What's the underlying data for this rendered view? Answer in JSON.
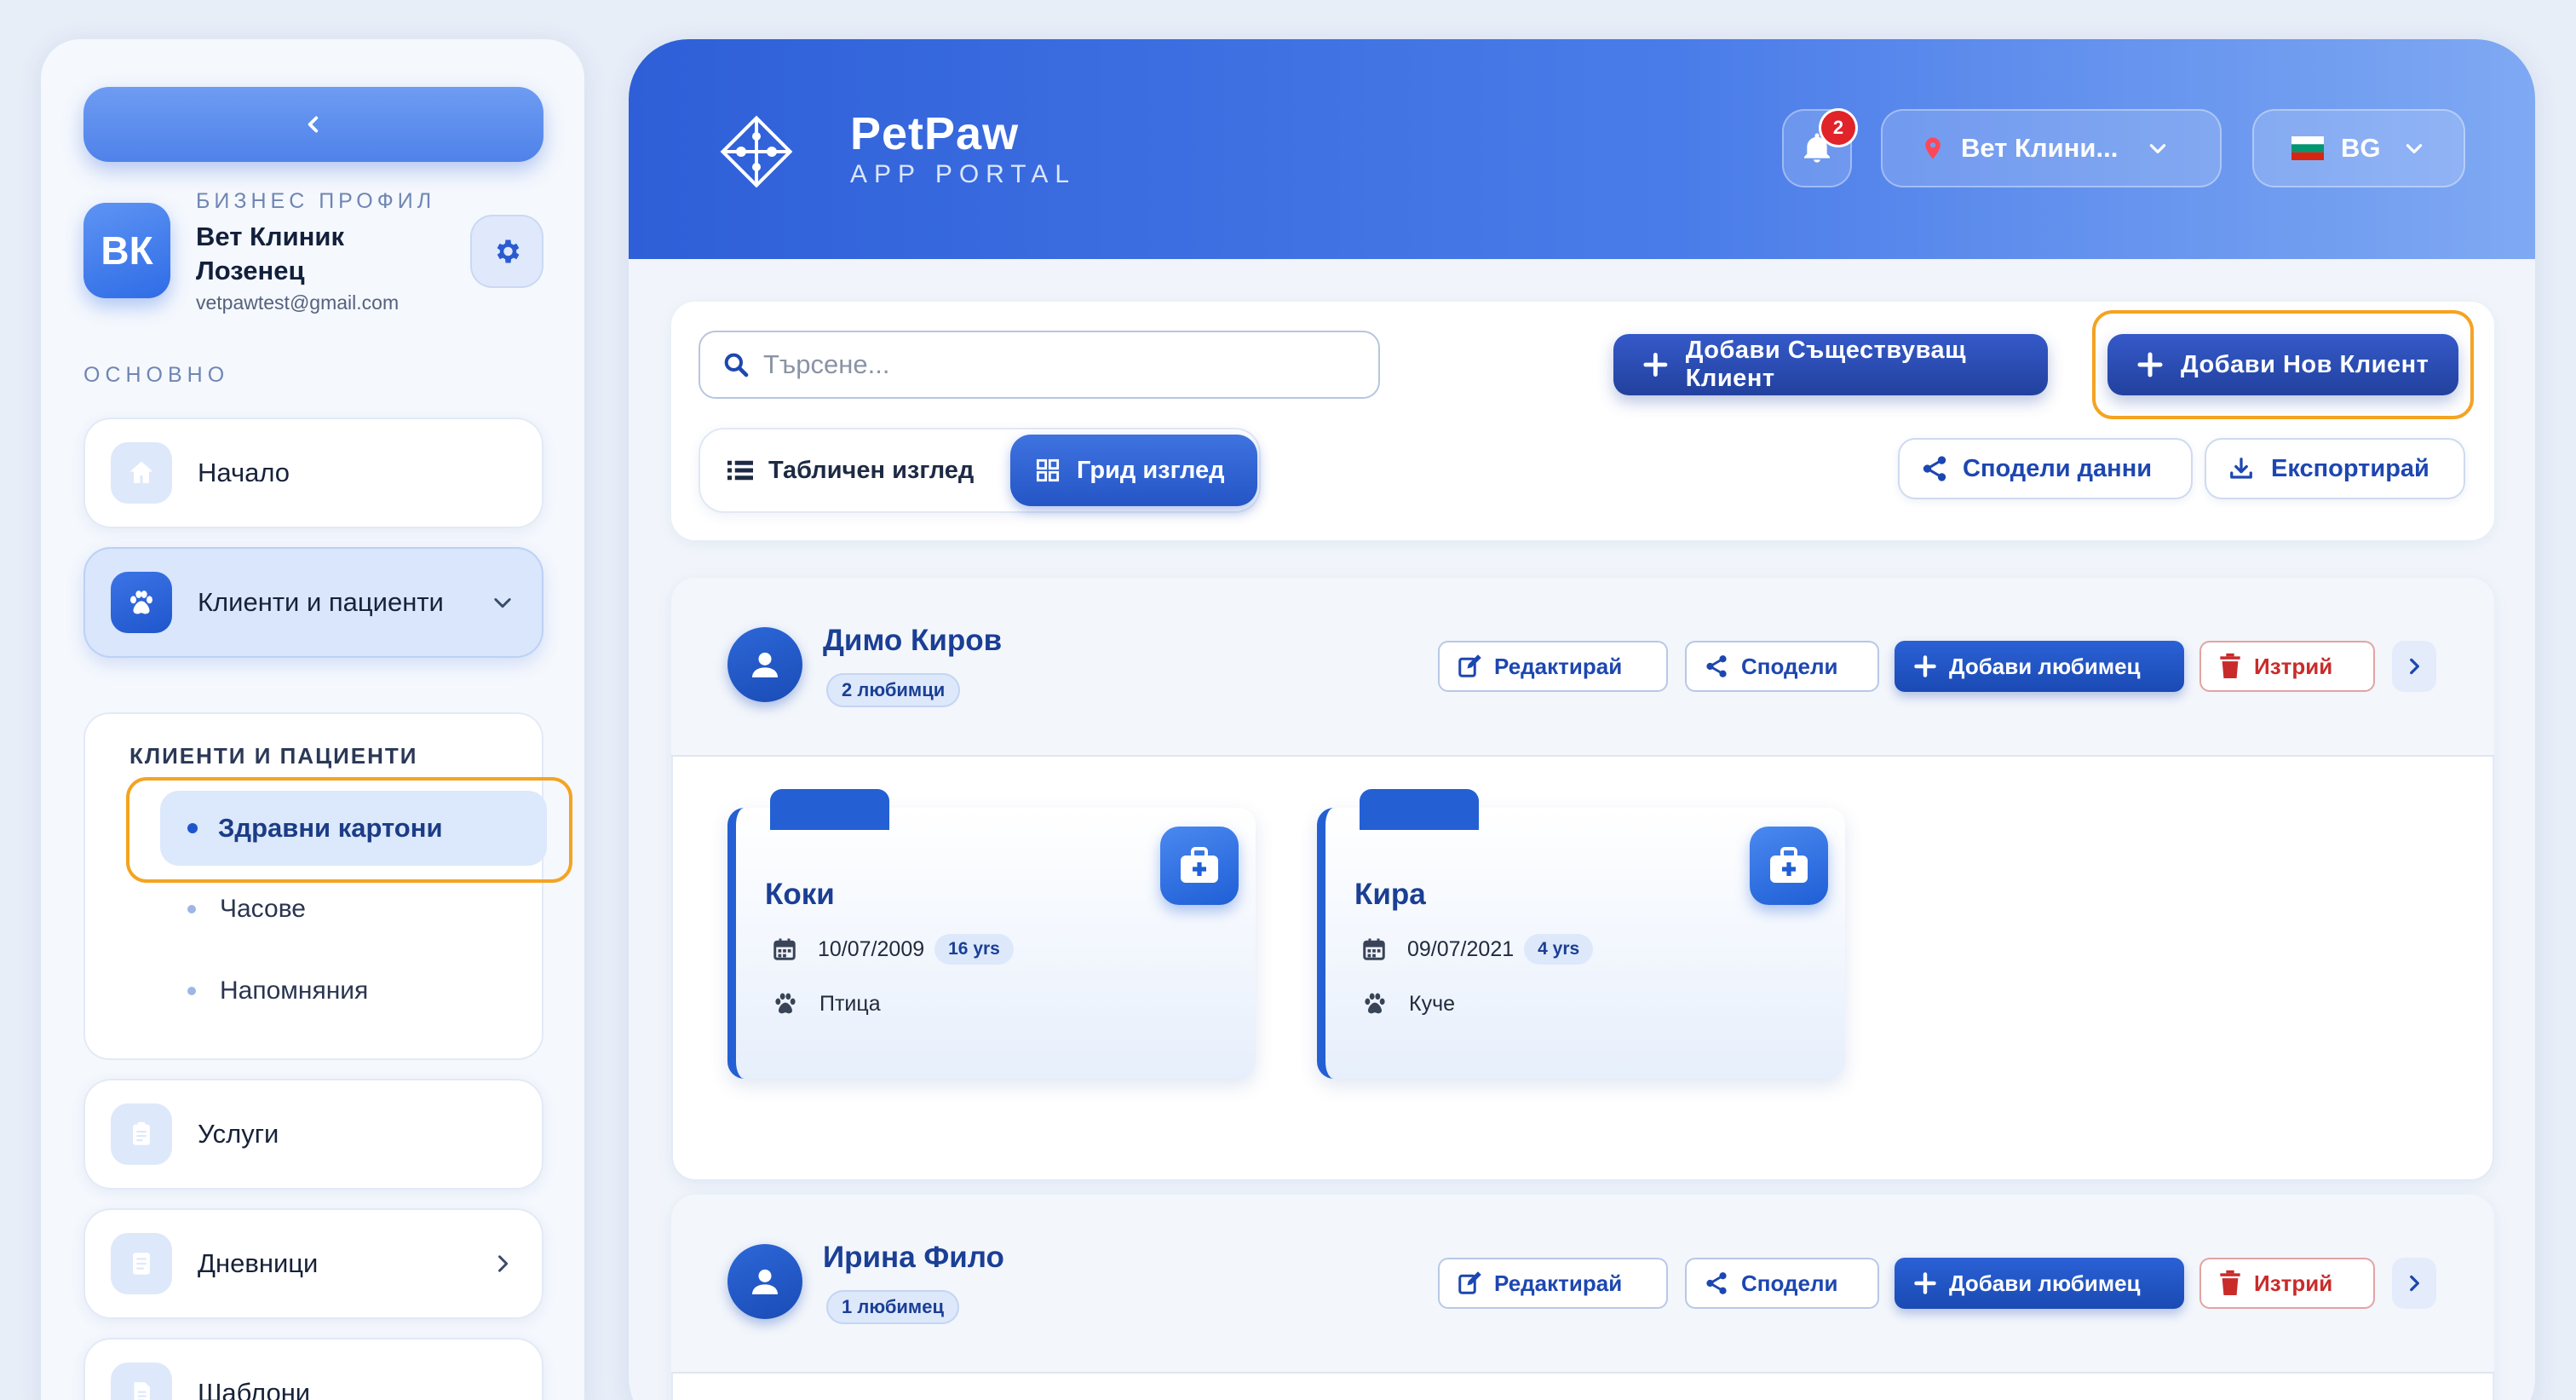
{
  "sidebar": {
    "business_label": "БИЗНЕС ПРОФИЛ",
    "avatar_initials": "ВК",
    "business_name": "Вет Клиник Лозенец",
    "email": "vetpawtest@gmail.com",
    "section_label": "ОСНОВНО",
    "items": [
      {
        "label": "Начало",
        "icon": "home-icon"
      },
      {
        "label": "Клиенти и пациенти",
        "icon": "paw-icon"
      },
      {
        "label": "Услуги",
        "icon": "clipboard-icon"
      },
      {
        "label": "Дневници",
        "icon": "journal-icon"
      },
      {
        "label": "Шаблони",
        "icon": "template-icon"
      }
    ],
    "submenu": {
      "title": "КЛИЕНТИ И ПАЦИЕНТИ",
      "items": [
        "Здравни картони",
        "Часове",
        "Напомняния"
      ]
    }
  },
  "header": {
    "app_name": "PetPaw",
    "app_subtitle": "APP PORTAL",
    "notification_count": "2",
    "clinic": "Вет Клини...",
    "language": "BG"
  },
  "toolbar": {
    "search_placeholder": "Търсене...",
    "view_table": "Табличен изглед",
    "view_grid": "Грид изглед",
    "add_existing_client": "Добави Съществуващ Клиент",
    "add_new_client": "Добави Нов Клиент",
    "share_data": "Сподели данни",
    "export": "Експортирай"
  },
  "actions": {
    "edit": "Редактирай",
    "share": "Сподели",
    "add_pet": "Добави любимец",
    "delete": "Изтрий"
  },
  "clients": [
    {
      "name": "Димо Киров",
      "pet_count": "2 любимци",
      "pets": [
        {
          "name": "Коки",
          "birthdate": "10/07/2009",
          "age": "16 yrs",
          "species": "Птица"
        },
        {
          "name": "Кира",
          "birthdate": "09/07/2021",
          "age": "4 yrs",
          "species": "Куче"
        }
      ]
    },
    {
      "name": "Ирина Фило",
      "pet_count": "1 любимец",
      "pets": []
    }
  ],
  "colors": {
    "accent": "#2460d4",
    "header_start": "#2e5fd8",
    "header_end": "#7fa9f3",
    "highlight": "#f4a322",
    "danger": "#c92b2b",
    "badge": "#e0242a"
  }
}
